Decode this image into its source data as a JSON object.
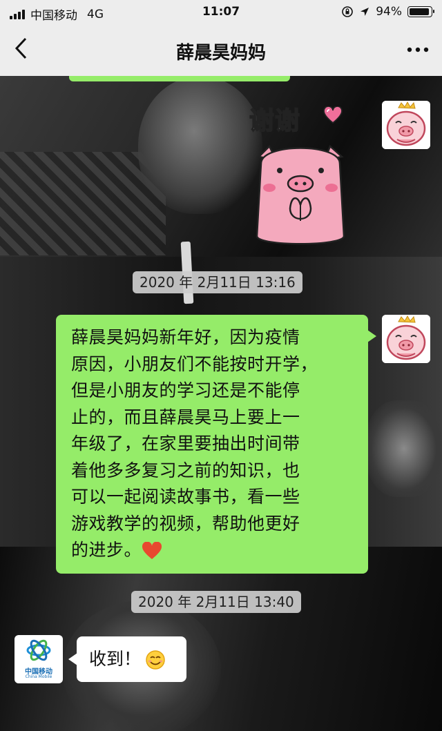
{
  "status_bar": {
    "carrier": "中国移动",
    "network": "4G",
    "time": "11:07",
    "battery": "94%"
  },
  "nav": {
    "back_icon": "chevron-left-icon",
    "title": "薛晨昊妈妈",
    "more_icon": "more-dots-icon"
  },
  "messages": [
    {
      "type": "sticker",
      "side": "right",
      "text": "谢谢"
    },
    {
      "type": "timestamp",
      "text": "2020 年 2月11日 13:16"
    },
    {
      "type": "text",
      "side": "right",
      "lines": [
        "薛晨昊妈妈新年好，因为疫情",
        "原因，小朋友们不能按时开学，",
        "但是小朋友的学习还是不能停",
        "止的，而且薛晨昊马上要上一",
        "年级了，在家里要抽出时间带",
        "着他多多复习之前的知识，也",
        "可以一起阅读故事书，看一些",
        "游戏教学的视频，帮助他更好",
        "的进步。"
      ]
    },
    {
      "type": "timestamp",
      "text": "2020 年 2月11日 13:40"
    },
    {
      "type": "text",
      "side": "left",
      "text": "收到！"
    }
  ],
  "avatars": {
    "self_logo_text": "中国移动",
    "self_logo_en": "China Mobile"
  },
  "colors": {
    "bubble_green": "#95ec69",
    "nav_bg": "#ededed"
  }
}
